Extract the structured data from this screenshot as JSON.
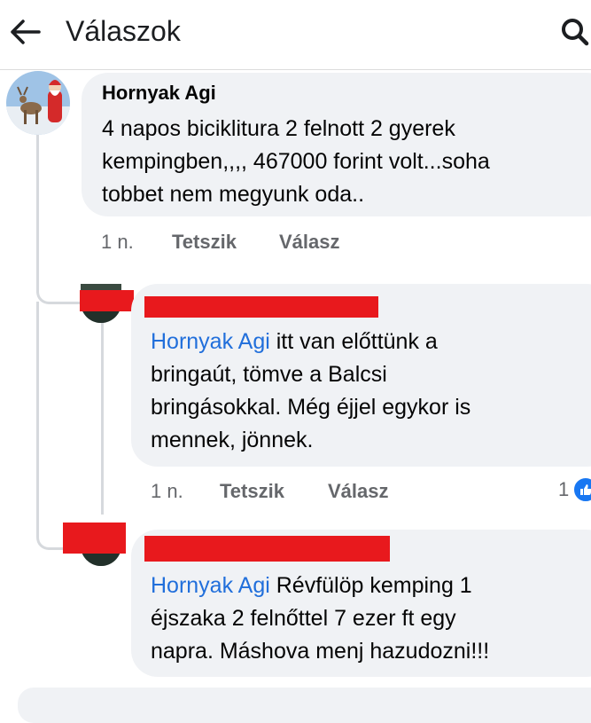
{
  "header": {
    "title": "Válaszok"
  },
  "comments": [
    {
      "author": "Hornyak Agi",
      "lines": [
        "4  napos biciklitura 2 felnott 2 gyerek",
        "kempingben,,,, 467000 forint volt...soha",
        "tobbet nem megyunk oda.."
      ],
      "time": "1 n.",
      "like": "Tetszik",
      "reply": "Válasz"
    },
    {
      "mention": "Hornyak Agi",
      "lines": [
        " itt van előttünk a",
        "bringaút, tömve a Balcsi",
        "bringásokkal. Még éjjel egykor is",
        "mennek, jönnek."
      ],
      "time": "1 n.",
      "like": "Tetszik",
      "reply": "Válasz",
      "reaction_count": "1"
    },
    {
      "mention": "Hornyak Agi",
      "lines": [
        " Révfülöp kemping 1",
        "éjszaka 2 felnőttel 7 ezer ft egy",
        "napra. Máshova menj hazudozni!!!"
      ]
    }
  ],
  "colors": {
    "mention": "#216fdb",
    "bubble": "#f0f2f5",
    "redaction": "#e8191d",
    "like_badge": "#1877f2"
  },
  "icons": [
    "back-arrow-icon",
    "search-icon",
    "like-reaction-icon"
  ]
}
